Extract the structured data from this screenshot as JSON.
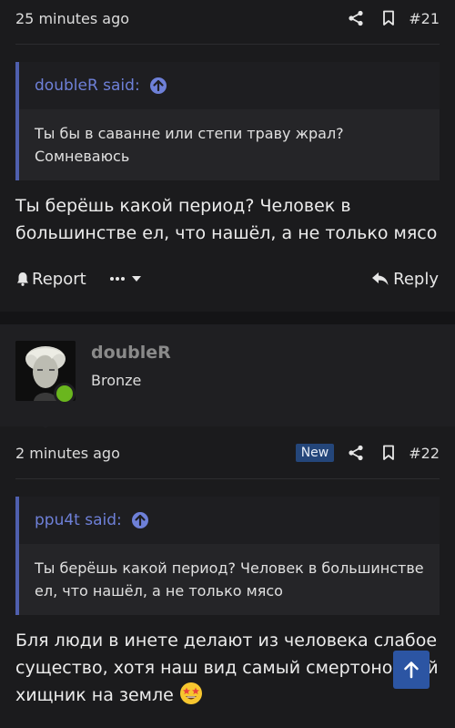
{
  "post1": {
    "time": "25 minutes ago",
    "number": "#21",
    "quote": {
      "author": "doubleR said:",
      "text": "Ты бы в саванне или степи траву жрал? Сомневаюсь"
    },
    "text": "Ты берёшь какой период? Человек в большинстве ел, что нашёл, а не только мясо",
    "actions": {
      "report": "Report",
      "reply": "Reply"
    }
  },
  "user": {
    "name": "doubleR",
    "rank": "Bronze"
  },
  "post2": {
    "time": "2 minutes ago",
    "badge": "New",
    "number": "#22",
    "quote": {
      "author": "ppu4t said:",
      "text": "Ты берёшь какой период? Человек в большинстве ел, что нашёл, а не только мясо"
    },
    "text": "Бля люди в инете делают из человека слабое существо, хотя наш вид самый смертоносный хищник на земле"
  },
  "colors": {
    "background": "#1b1b1d",
    "quote_accent": "#4f5fae",
    "quote_author": "#6e80d8",
    "online": "#6ab61e",
    "badge": "#24467a",
    "scroll_top": "#2c55a3"
  },
  "icons": {
    "share": "share-icon",
    "bookmark": "bookmark-icon",
    "quote_jump": "arrow-up-circle-icon",
    "report": "bell-icon",
    "more": "more-dots-icon",
    "reply": "reply-icon",
    "scroll_top": "arrow-up-icon",
    "emoji": "star-struck-emoji-icon"
  }
}
